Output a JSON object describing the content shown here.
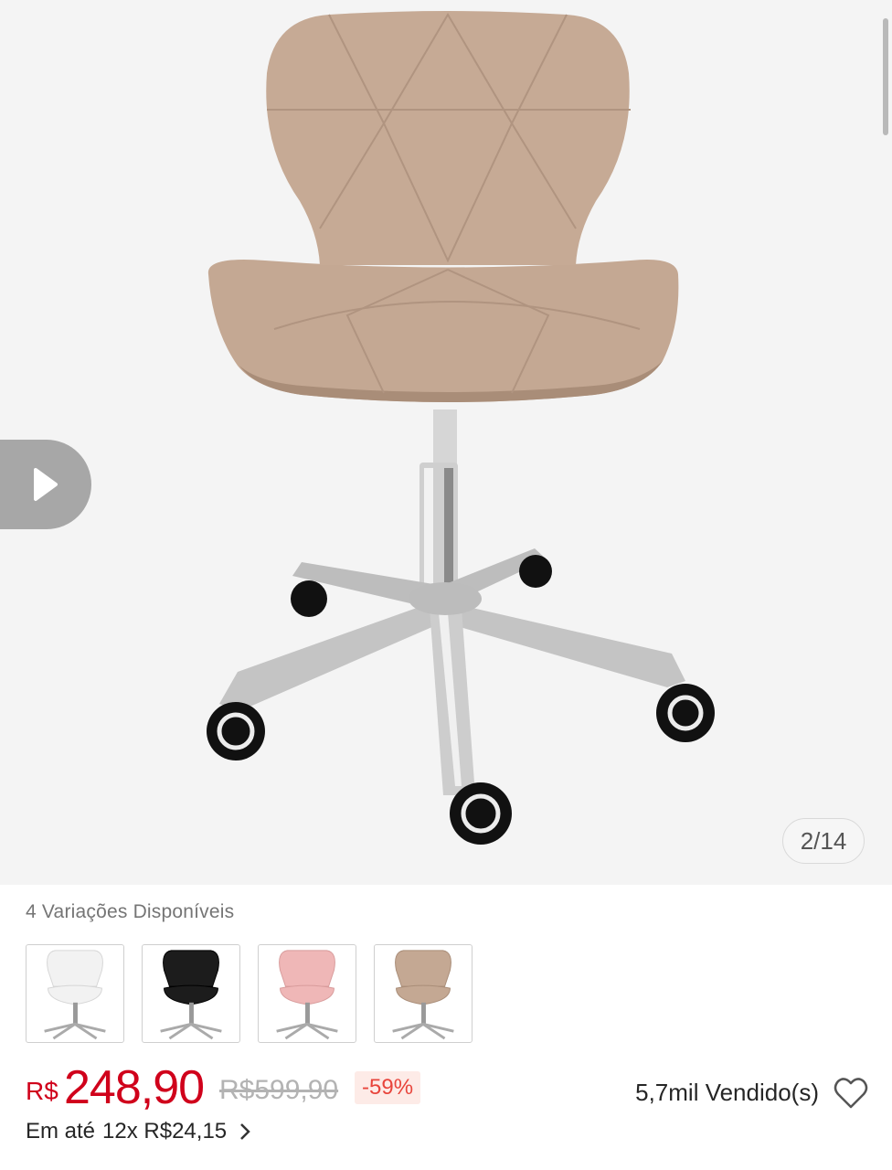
{
  "gallery": {
    "counter": "2/14",
    "play_icon": "play-icon",
    "colors": {
      "seat": "#c4a893",
      "seat_shadow": "#a98d78",
      "chrome": "#c9c9c9",
      "wheel": "#111111"
    }
  },
  "variations": {
    "label": "4 Variações Disponíveis",
    "items": [
      {
        "name": "white",
        "color": "#f2f2f2"
      },
      {
        "name": "black",
        "color": "#1c1c1c"
      },
      {
        "name": "pink",
        "color": "#efb7b7"
      },
      {
        "name": "nude",
        "color": "#c4a893"
      }
    ]
  },
  "pricing": {
    "currency": "R$",
    "price": "248,90",
    "original_price": "R$599,90",
    "discount": "-59%",
    "sold": "5,7mil Vendido(s)",
    "installments_prefix": "Em até",
    "installments_value": "12x R$24,15",
    "accent_color": "#d0011b"
  }
}
